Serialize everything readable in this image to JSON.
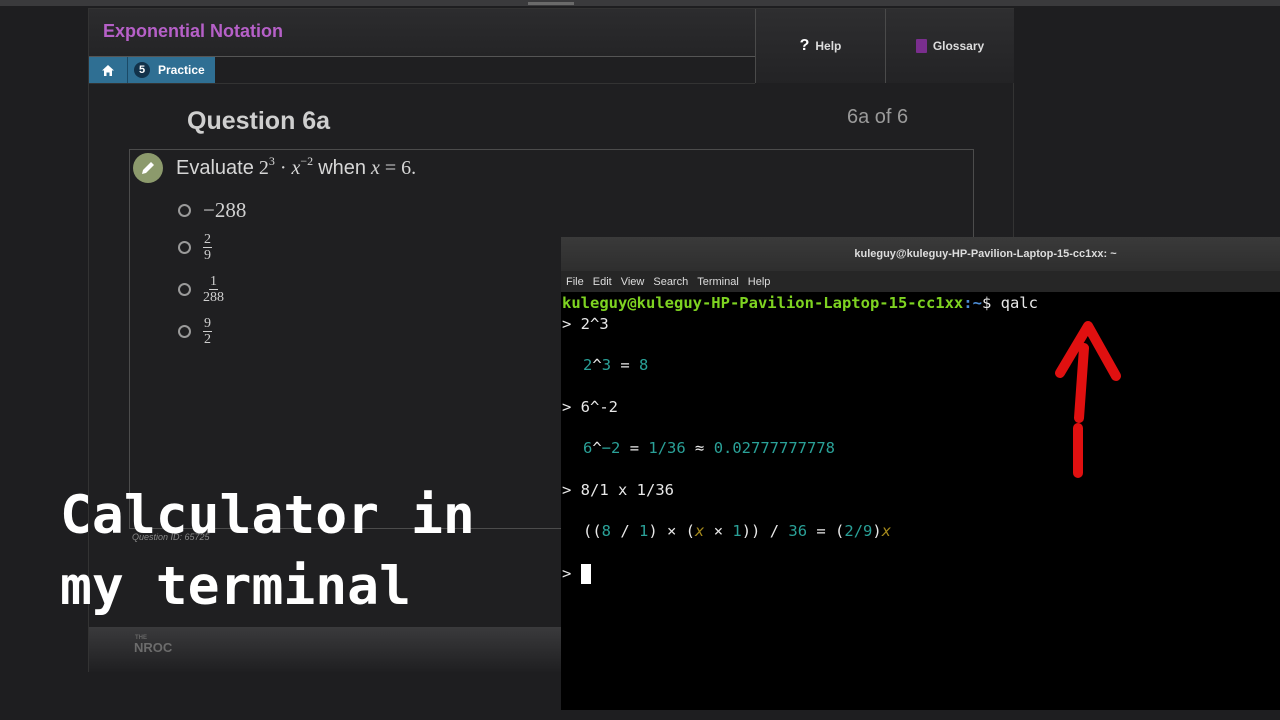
{
  "lesson": {
    "title": "Exponential Notation",
    "breadcrumb": {
      "step_number": "5",
      "label": "Practice"
    },
    "help_label": "Help",
    "glossary_label": "Glossary",
    "question_title": "Question 6a",
    "question_count": "6a of 6",
    "prompt": {
      "word": "Evaluate",
      "base": "2",
      "exp1": "3",
      "var": "x",
      "exp2": "−2",
      "when": "when",
      "var2": "x",
      "value": "6"
    },
    "options": [
      {
        "type": "text",
        "text": "−288"
      },
      {
        "type": "frac",
        "num": "2",
        "den": "9"
      },
      {
        "type": "frac",
        "num": "1",
        "den": "288"
      },
      {
        "type": "frac",
        "num": "9",
        "den": "2"
      }
    ],
    "question_id": "Question ID: 65725",
    "logo_the": "THE",
    "logo": "NROC"
  },
  "caption": {
    "line1": "Calculator in",
    "line2": "my terminal"
  },
  "terminal": {
    "title": "kuleguy@kuleguy-HP-Pavilion-Laptop-15-cc1xx: ~",
    "menu": [
      "File",
      "Edit",
      "View",
      "Search",
      "Terminal",
      "Help"
    ],
    "prompt_user": "kuleguy@kuleguy-HP-Pavilion-Laptop-15-cc1xx",
    "prompt_path": ":~",
    "prompt_cmd": "$ qalc",
    "lines": [
      {
        "input": "> 2^3",
        "result": [
          [
            "2",
            "teal"
          ],
          [
            "^",
            ""
          ],
          [
            "3",
            "teal"
          ],
          [
            " = ",
            ""
          ],
          [
            "8",
            "teal"
          ]
        ]
      },
      {
        "input": "> 6^-2",
        "result": [
          [
            "6",
            "teal"
          ],
          [
            "^",
            ""
          ],
          [
            "−2",
            "teal"
          ],
          [
            " = ",
            ""
          ],
          [
            "1/36",
            "teal"
          ],
          [
            " ≈ ",
            ""
          ],
          [
            "0.02777777778",
            "teal"
          ]
        ]
      },
      {
        "input": "> 8/1 x 1/36",
        "result": [
          [
            "((",
            ""
          ],
          [
            "8",
            "teal"
          ],
          [
            " / ",
            ""
          ],
          [
            "1",
            "teal"
          ],
          [
            ") × (",
            ""
          ],
          [
            "x",
            "yel"
          ],
          [
            " × ",
            ""
          ],
          [
            "1",
            "teal"
          ],
          [
            ")) / ",
            ""
          ],
          [
            "36",
            "teal"
          ],
          [
            " = (",
            ""
          ],
          [
            "2/9",
            "teal"
          ],
          [
            ")",
            ""
          ],
          [
            "x",
            "yel"
          ]
        ]
      }
    ],
    "final_prompt": "> "
  },
  "colors": {
    "lesson_title": "#b660c8",
    "breadcrumb": "#2f6f93",
    "prompt_green": "#7ed321",
    "path_blue": "#4c8dd6",
    "number_teal": "#2aa198",
    "annotation_red": "#e01010"
  }
}
